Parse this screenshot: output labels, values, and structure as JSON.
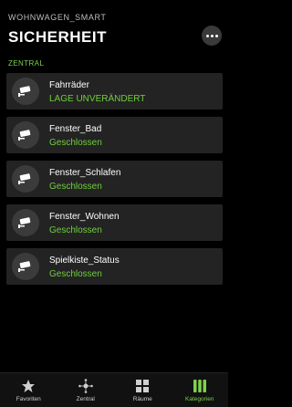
{
  "header": {
    "app_name": "WOHNWAGEN_SMART",
    "title": "SICHERHEIT"
  },
  "section": {
    "label": "ZENTRAL"
  },
  "items": [
    {
      "name": "Fahrräder",
      "state": "LAGE UNVERÄNDERT",
      "icon": "camera-icon"
    },
    {
      "name": "Fenster_Bad",
      "state": "Geschlossen",
      "icon": "camera-icon"
    },
    {
      "name": "Fenster_Schlafen",
      "state": "Geschlossen",
      "icon": "camera-icon"
    },
    {
      "name": "Fenster_Wohnen",
      "state": "Geschlossen",
      "icon": "camera-icon"
    },
    {
      "name": "Spielkiste_Status",
      "state": "Geschlossen",
      "icon": "camera-icon"
    }
  ],
  "tabbar": {
    "tabs": [
      {
        "label": "Favoriten",
        "icon": "star-icon",
        "active": false
      },
      {
        "label": "Zentral",
        "icon": "hub-icon",
        "active": false
      },
      {
        "label": "Räume",
        "icon": "grid-icon",
        "active": false
      },
      {
        "label": "Kategorien",
        "icon": "categories-icon",
        "active": true
      }
    ]
  },
  "colors": {
    "accent": "#6fce3d",
    "card": "#232323",
    "background": "#000000"
  }
}
